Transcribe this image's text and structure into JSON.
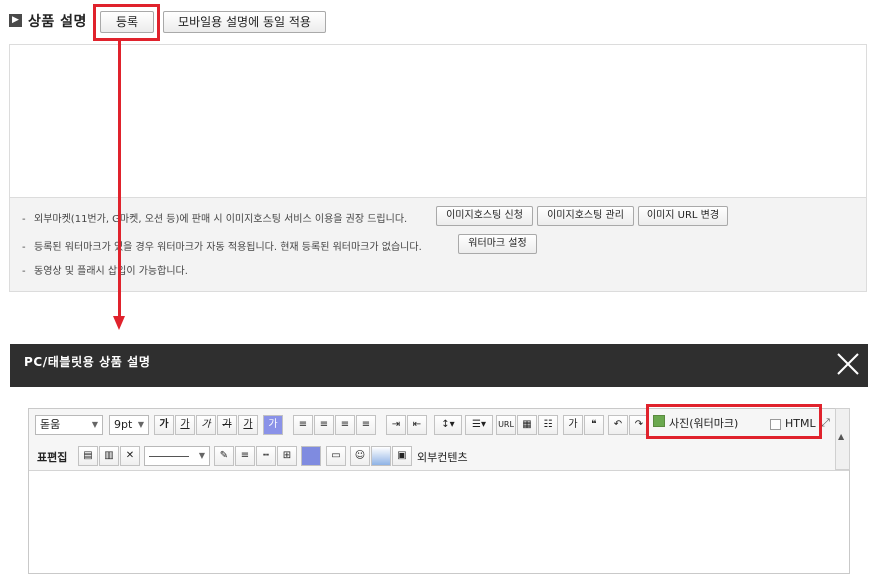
{
  "top": {
    "title_icon": "chevron-right-icon",
    "title": "상품 설명",
    "register_button": "등록",
    "mobile_button": "모바일용 설명에 동일 적용"
  },
  "notice": {
    "line1": "외부마켓(11번가, G마켓, 오션 등)에 판매 시 이미지호스팅 서비스 이용을 권장 드립니다.",
    "line1_buttons": [
      "이미지호스팅 신청",
      "이미지호스팅 관리",
      "이미지 URL 변경"
    ],
    "line2": "등록된 워터마크가 있을 경우 워터마크가 자동 적용됩니다. 현재 등록된 워터마크가 없습니다.",
    "line2_button": "워터마크 설정",
    "line3": "동영상 및 플래시 삽입이 가능합니다."
  },
  "dialog": {
    "title": "PC/태블릿용 상품 설명",
    "close_icon": "close-icon"
  },
  "editor": {
    "font_select": "돋움",
    "size_select": "9pt",
    "row1_buttons": [
      "가",
      "가",
      "가",
      "가",
      "가",
      "가"
    ],
    "photo_label": "사진(워터마크)",
    "html_label": "HTML",
    "row2_label": "표편집",
    "external_content_label": "외부컨텐츠"
  },
  "colors": {
    "accent_red": "#e0222c",
    "dark_bar": "#2f2f2f"
  }
}
